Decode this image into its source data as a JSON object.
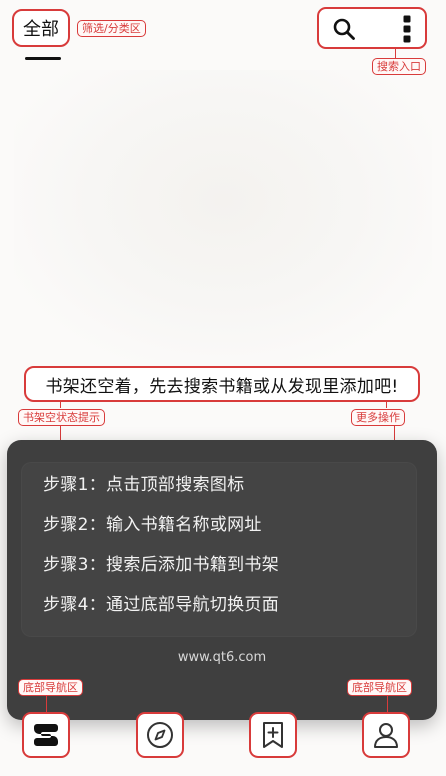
{
  "header": {
    "tab_all": "全部",
    "filter_tag": "筛选/分类区",
    "search_tag": "搜索入口"
  },
  "empty_state": {
    "message": "书架还空着，先去搜索书籍或从发现里添加吧!",
    "status_tag": "书架空状态提示",
    "more_tag": "更多操作"
  },
  "guide": {
    "steps": [
      "步骤1：点击顶部搜索图标",
      "步骤2：输入书籍名称或网址",
      "步骤3：搜索后添加书籍到书架",
      "步骤4：通过底部导航切换页面"
    ],
    "site": "www.qt6.com"
  },
  "bottom_nav": {
    "left_tag": "底部导航区",
    "right_tag": "底部导航区",
    "items": [
      {
        "icon": "bookshelf-icon"
      },
      {
        "icon": "compass-icon"
      },
      {
        "icon": "bookmark-add-icon"
      },
      {
        "icon": "profile-icon"
      }
    ]
  },
  "colors": {
    "annotation": "#d83b3b",
    "panel": "#3f3f3f",
    "text": "#111111"
  }
}
